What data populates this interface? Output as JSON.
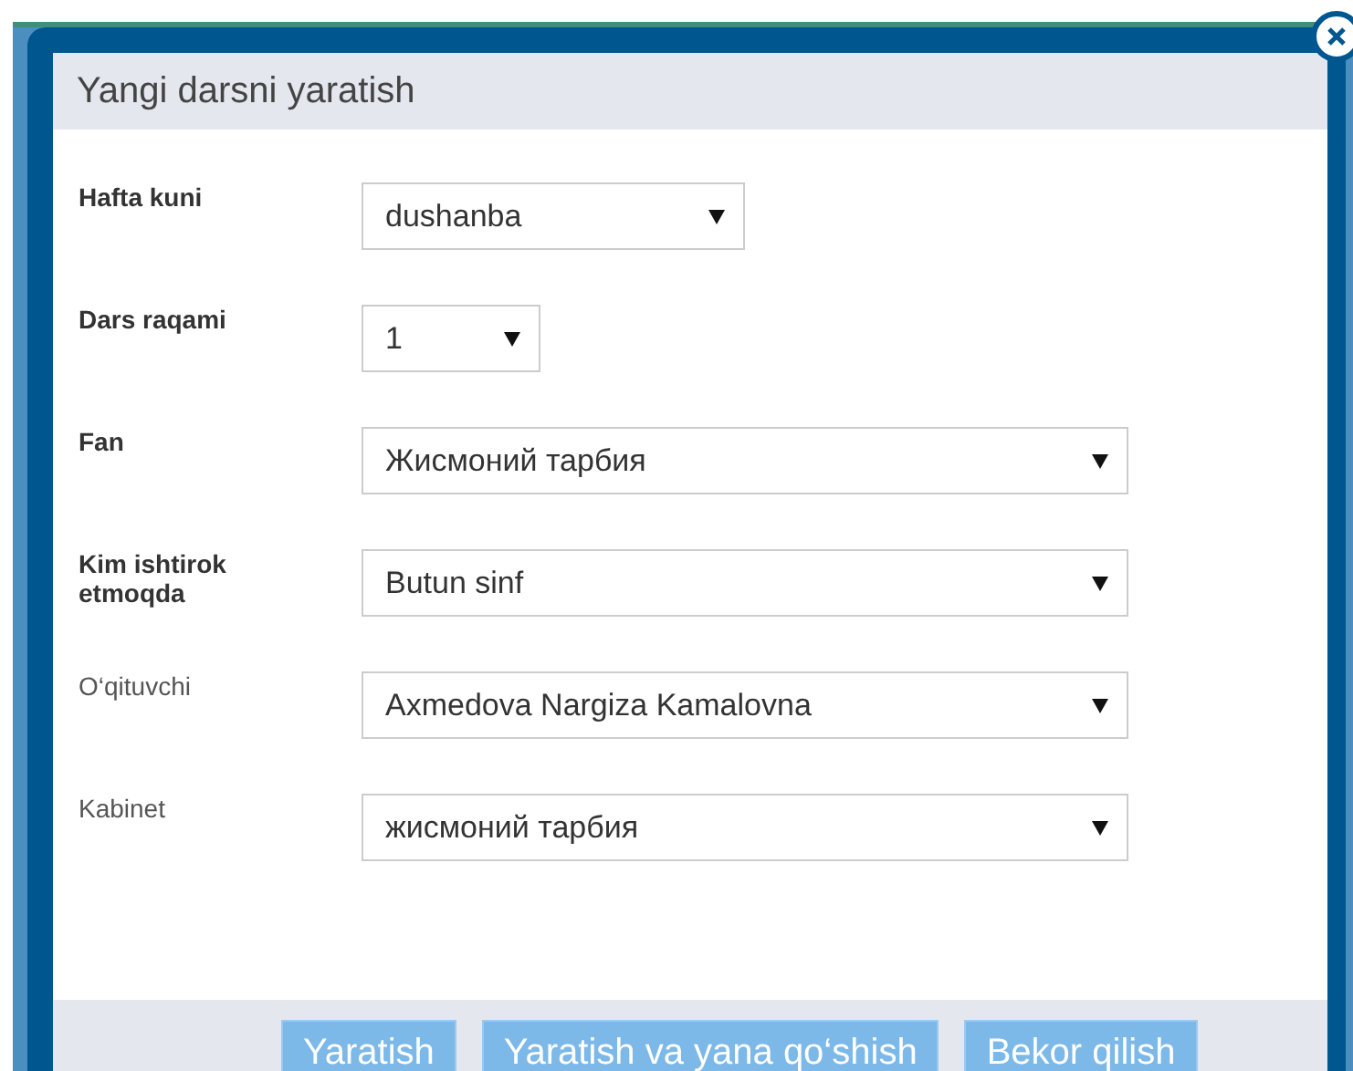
{
  "dialog": {
    "title": "Yangi darsni yaratish",
    "fields": [
      {
        "label": "Hafta kuni",
        "label_bold": true,
        "value": "dushanba",
        "kind": "short"
      },
      {
        "label": "Dars raqami",
        "label_bold": true,
        "value": "1",
        "kind": "tiny"
      },
      {
        "label": "Fan",
        "label_bold": true,
        "value": "Жисмоний тарбия",
        "kind": "wide"
      },
      {
        "label": "Kim ishtirok etmoqda",
        "label_bold": true,
        "value": "Butun sinf",
        "kind": "wide"
      },
      {
        "label": "O‘qituvchi",
        "label_bold": false,
        "value": "Axmedova Nargiza Kamalovna",
        "kind": "wide"
      },
      {
        "label": "Kabinet",
        "label_bold": false,
        "value": "жисмоний тарбия",
        "kind": "wide"
      }
    ],
    "buttons": [
      "Yaratish",
      "Yaratish va yana qo‘shish",
      "Bekor qilish"
    ]
  }
}
